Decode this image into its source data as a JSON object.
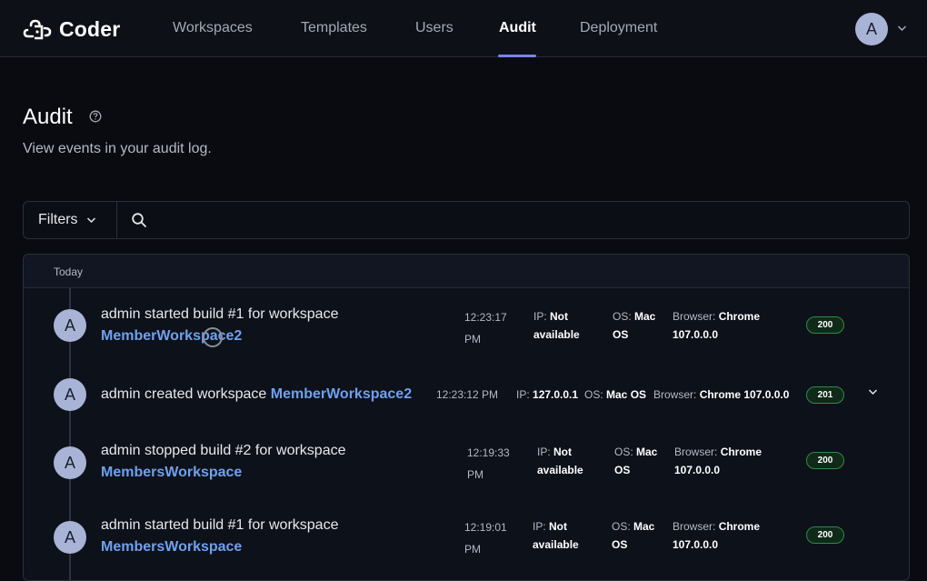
{
  "app": {
    "logo_text": "Coder",
    "nav": [
      "Workspaces",
      "Templates",
      "Users",
      "Audit",
      "Deployment"
    ],
    "active_nav": "Audit",
    "user_avatar_letter": "A"
  },
  "page": {
    "title": "Audit",
    "subtitle": "View events in your audit log."
  },
  "filters": {
    "label": "Filters",
    "search_placeholder": "",
    "search_value": ""
  },
  "log": {
    "group_label": "Today",
    "entries": [
      {
        "avatar": "A",
        "text": "admin started build #1 for workspace",
        "resource": "MemberWorkspace2",
        "time": "12:23:17 PM",
        "ip_label": "IP:",
        "ip": "Not available",
        "os_label": "OS:",
        "os": "Mac OS",
        "browser_label": "Browser:",
        "browser": "Chrome 107.0.0.0",
        "status": "200"
      },
      {
        "avatar": "A",
        "text": "admin created workspace",
        "resource": "MemberWorkspace2",
        "time": "12:23:12 PM",
        "ip_label": "IP:",
        "ip": "127.0.0.1",
        "os_label": "OS:",
        "os": "Mac OS",
        "browser_label": "Browser:",
        "browser": "Chrome 107.0.0.0",
        "status": "201"
      },
      {
        "avatar": "A",
        "text": "admin stopped build #2 for workspace",
        "resource": "MembersWorkspace",
        "time": "12:19:33 PM",
        "ip_label": "IP:",
        "ip": "Not available",
        "os_label": "OS:",
        "os": "Mac OS",
        "browser_label": "Browser:",
        "browser": "Chrome 107.0.0.0",
        "status": "200"
      },
      {
        "avatar": "A",
        "text": "admin started build #1 for workspace",
        "resource": "MembersWorkspace",
        "time": "12:19:01 PM",
        "ip_label": "IP:",
        "ip": "Not available",
        "os_label": "OS:",
        "os": "Mac OS",
        "browser_label": "Browser:",
        "browser": "Chrome 107.0.0.0",
        "status": "200"
      }
    ]
  },
  "colors": {
    "background": "#090b10",
    "link": "#6ea1ee",
    "accent": "#7a83e8",
    "success_border": "#2e8b46"
  }
}
